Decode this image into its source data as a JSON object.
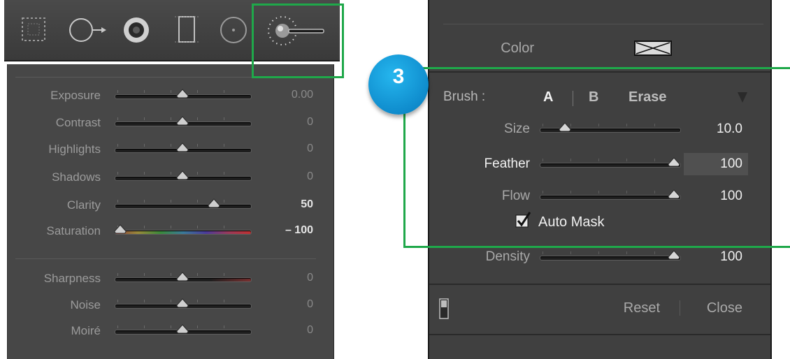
{
  "left_panel": {
    "toolbar_tools": [
      {
        "icon": "crop-overlay-icon"
      },
      {
        "icon": "spot-removal-icon"
      },
      {
        "icon": "red-eye-icon"
      },
      {
        "icon": "graduated-filter-icon"
      },
      {
        "icon": "radial-filter-icon"
      },
      {
        "icon": "adjustment-brush-icon",
        "highlighted": true
      }
    ],
    "sliders": [
      {
        "label": "Exposure",
        "value": "0.00",
        "level": 0.5
      },
      {
        "label": "Contrast",
        "value": "0",
        "level": 0.5
      },
      {
        "label": "Highlights",
        "value": "0",
        "level": 0.5
      },
      {
        "label": "Shadows",
        "value": "0",
        "level": 0.5
      },
      {
        "label": "Clarity",
        "value": "50",
        "level": 0.75
      },
      {
        "label": "Saturation",
        "value": "– 100",
        "level": 0.0
      },
      {
        "label": "Sharpness",
        "value": "0",
        "level": 0.5
      },
      {
        "label": "Noise",
        "value": "0",
        "level": 0.5
      },
      {
        "label": "Moiré",
        "value": "0",
        "level": 0.5
      }
    ]
  },
  "right_panel": {
    "color_label": "Color",
    "color_swatch_icon": "no-color-swatch-icon",
    "brush": {
      "label": "Brush :",
      "option_a": "A",
      "option_b": "B",
      "option_erase": "Erase",
      "menu_icon": "triangle-down-icon"
    },
    "sliders": [
      {
        "label": "Size",
        "value": "10.0",
        "level": 0.15
      },
      {
        "label": "Feather",
        "value": "100",
        "level": 1.0
      },
      {
        "label": "Flow",
        "value": "100",
        "level": 1.0
      }
    ],
    "auto_mask": {
      "label": "Auto Mask",
      "checked": true
    },
    "density": {
      "label": "Density",
      "value": "100",
      "level": 1.0
    },
    "footer": {
      "reset_label": "Reset",
      "close_label": "Close"
    }
  },
  "annotation": {
    "step_number": "3",
    "highlight_color": "#1fa84a",
    "badge_color": "#1493d6"
  }
}
